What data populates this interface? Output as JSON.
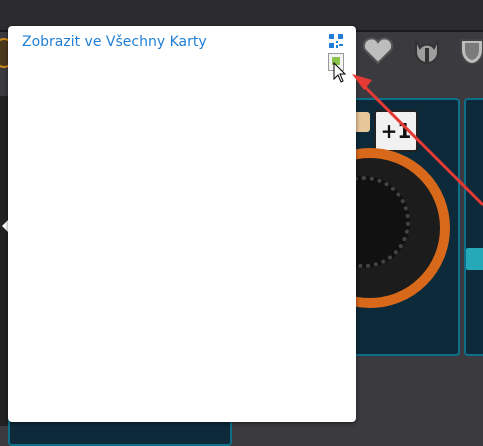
{
  "popup": {
    "link_label": "Zobrazit ve Všechny Karty"
  },
  "cards": {
    "card1": {
      "badge": "+1"
    }
  },
  "icons": {
    "top_bar": [
      "heart-icon",
      "helmet-icon",
      "shield-icon"
    ],
    "popup": [
      "qr-code-icon",
      "broken-image-icon"
    ]
  },
  "colors": {
    "link": "#1f7fd6",
    "annotation_arrow": "#e53935",
    "card_border": "#0d6f8a"
  }
}
